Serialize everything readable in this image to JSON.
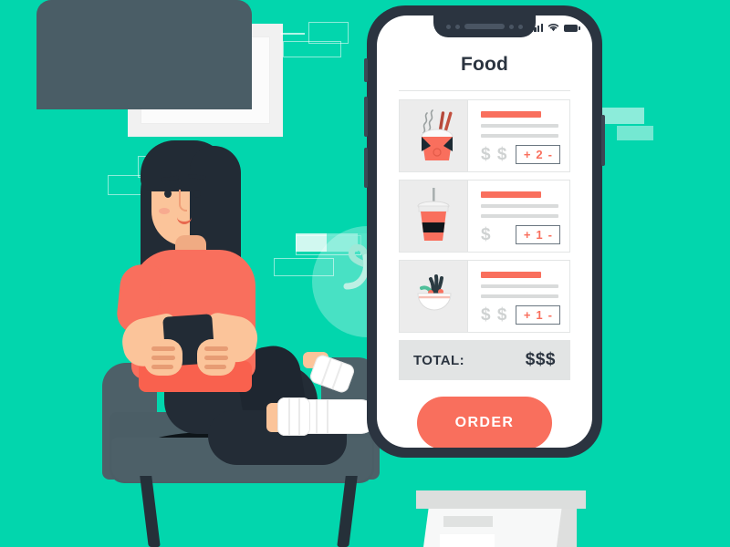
{
  "theme": {
    "background": "#02d6ad",
    "accent": "#f96f5d",
    "dark": "#2b3440",
    "chair": "#4d6068",
    "skin": "#fbc49a"
  },
  "scene": {
    "name": "food-delivery-app-illustration",
    "frame": {
      "name": "wall-picture-frame"
    },
    "chair": {
      "name": "armchair"
    },
    "person": {
      "name": "woman-sitting-with-phone"
    },
    "box": {
      "name": "delivery-box"
    },
    "logo": {
      "name": "script-logo-watermark"
    }
  },
  "phone": {
    "status_bar": {
      "signal_icon": "signal-bars-icon",
      "wifi_icon": "wifi-icon",
      "battery_icon": "battery-icon"
    },
    "app": {
      "title": "Food",
      "items": [
        {
          "thumb_icon": "noodle-takeout-box-icon",
          "name_placeholder": "",
          "price": "$ $",
          "stepper": {
            "plus": "+",
            "qty": "2",
            "minus": "-"
          }
        },
        {
          "thumb_icon": "drink-cup-icon",
          "name_placeholder": "",
          "price": "$",
          "stepper": {
            "plus": "+",
            "qty": "1",
            "minus": "-"
          }
        },
        {
          "thumb_icon": "salad-bowl-icon",
          "name_placeholder": "",
          "price": "$ $",
          "stepper": {
            "plus": "+",
            "qty": "1",
            "minus": "-"
          }
        }
      ],
      "total": {
        "label": "TOTAL:",
        "value": "$$$"
      },
      "order_button": "ORDER"
    }
  }
}
